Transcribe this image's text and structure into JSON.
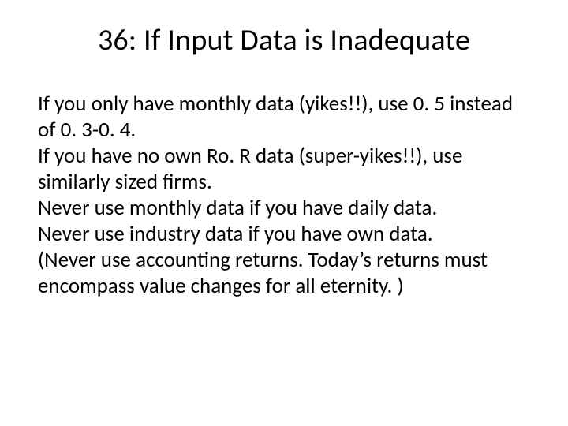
{
  "slide": {
    "title": "36: If Input Data is Inadequate",
    "paragraphs": [
      "If you only have monthly data (yikes!!), use 0. 5 instead of 0. 3-0. 4.",
      "If you have no own Ro. R data (super-yikes!!), use similarly sized firms.",
      "Never use monthly data if you have daily data.",
      "Never use industry data if you have own data.",
      "(Never use accounting returns. Today’s returns must encompass value changes for all eternity. )"
    ]
  }
}
